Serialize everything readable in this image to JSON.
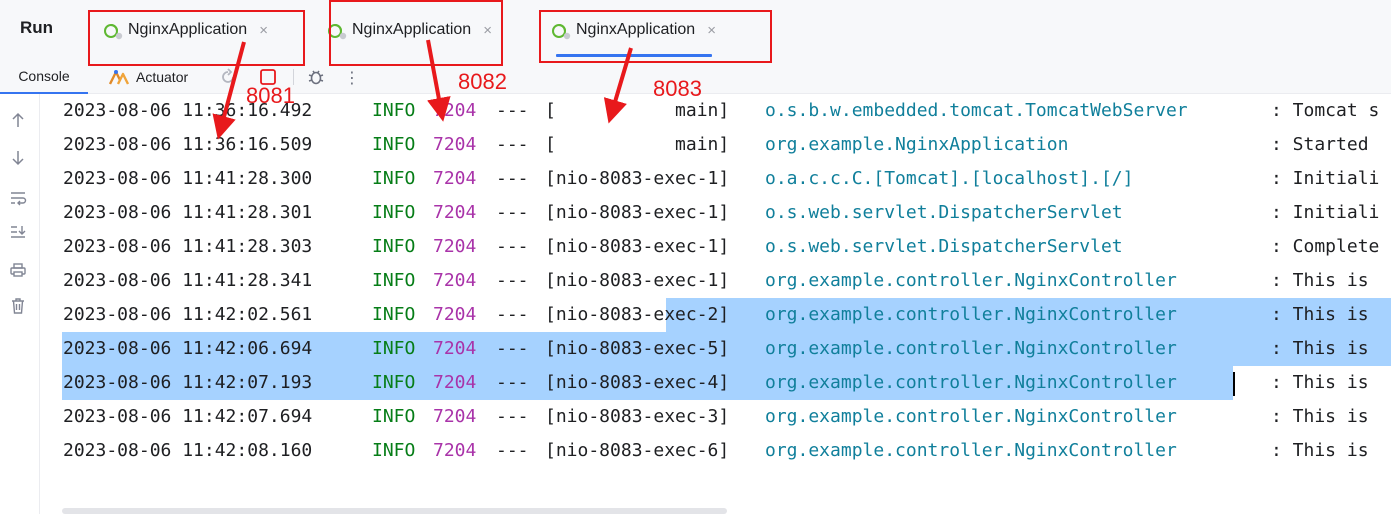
{
  "run_panel": {
    "label": "Run",
    "tabs": [
      {
        "label": "NginxApplication",
        "active": false
      },
      {
        "label": "NginxApplication",
        "active": false
      },
      {
        "label": "NginxApplication",
        "active": true
      }
    ],
    "close_glyph": "×"
  },
  "toolbar": {
    "console_label": "Console",
    "actuator_label": "Actuator",
    "more_glyph": "⋮",
    "icons": [
      "rerun-icon",
      "stop-icon",
      "debug-icon",
      "more-icon"
    ]
  },
  "gutter_icons": [
    "scroll-up-icon",
    "scroll-down-icon",
    "soft-wrap-icon",
    "scroll-to-end-icon",
    "print-icon",
    "clear-icon"
  ],
  "log": {
    "colors": {
      "level": "#067d17",
      "pid": "#a933a9",
      "logger": "#107f9b",
      "selection": "#a6d2ff"
    },
    "lines": [
      {
        "ts": "2023-08-06 11:36:16.492",
        "level": "INFO",
        "pid": "7204",
        "sep": "---",
        "thread": "[           main]",
        "logger": "o.s.b.w.embedded.tomcat.TomcatWebServer",
        "msg": ": Tomcat s"
      },
      {
        "ts": "2023-08-06 11:36:16.509",
        "level": "INFO",
        "pid": "7204",
        "sep": "---",
        "thread": "[           main]",
        "logger": "org.example.NginxApplication",
        "msg": ": Started"
      },
      {
        "ts": "2023-08-06 11:41:28.300",
        "level": "INFO",
        "pid": "7204",
        "sep": "---",
        "thread": "[nio-8083-exec-1]",
        "logger": "o.a.c.c.C.[Tomcat].[localhost].[/]",
        "msg": ": Initiali"
      },
      {
        "ts": "2023-08-06 11:41:28.301",
        "level": "INFO",
        "pid": "7204",
        "sep": "---",
        "thread": "[nio-8083-exec-1]",
        "logger": "o.s.web.servlet.DispatcherServlet",
        "msg": ": Initiali"
      },
      {
        "ts": "2023-08-06 11:41:28.303",
        "level": "INFO",
        "pid": "7204",
        "sep": "---",
        "thread": "[nio-8083-exec-1]",
        "logger": "o.s.web.servlet.DispatcherServlet",
        "msg": ": Complete"
      },
      {
        "ts": "2023-08-06 11:41:28.341",
        "level": "INFO",
        "pid": "7204",
        "sep": "---",
        "thread": "[nio-8083-exec-1]",
        "logger": "org.example.controller.NginxController",
        "msg": ": This is"
      },
      {
        "ts": "2023-08-06 11:42:02.561",
        "level": "INFO",
        "pid": "7204",
        "sep": "---",
        "thread": "[nio-8083-exec-2]",
        "logger": "org.example.controller.NginxController",
        "msg": ": This is"
      },
      {
        "ts": "2023-08-06 11:42:06.694",
        "level": "INFO",
        "pid": "7204",
        "sep": "---",
        "thread": "[nio-8083-exec-5]",
        "logger": "org.example.controller.NginxController",
        "msg": ": This is"
      },
      {
        "ts": "2023-08-06 11:42:07.193",
        "level": "INFO",
        "pid": "7204",
        "sep": "---",
        "thread": "[nio-8083-exec-4]",
        "logger": "org.example.controller.NginxController",
        "msg": ": This is"
      },
      {
        "ts": "2023-08-06 11:42:07.694",
        "level": "INFO",
        "pid": "7204",
        "sep": "---",
        "thread": "[nio-8083-exec-3]",
        "logger": "org.example.controller.NginxController",
        "msg": ": This is"
      },
      {
        "ts": "2023-08-06 11:42:08.160",
        "level": "INFO",
        "pid": "7204",
        "sep": "---",
        "thread": "[nio-8083-exec-6]",
        "logger": "org.example.controller.NginxController",
        "msg": ": This is"
      }
    ]
  },
  "annotations": {
    "color": "#e8191c",
    "ports": [
      "8081",
      "8082",
      "8083"
    ]
  }
}
